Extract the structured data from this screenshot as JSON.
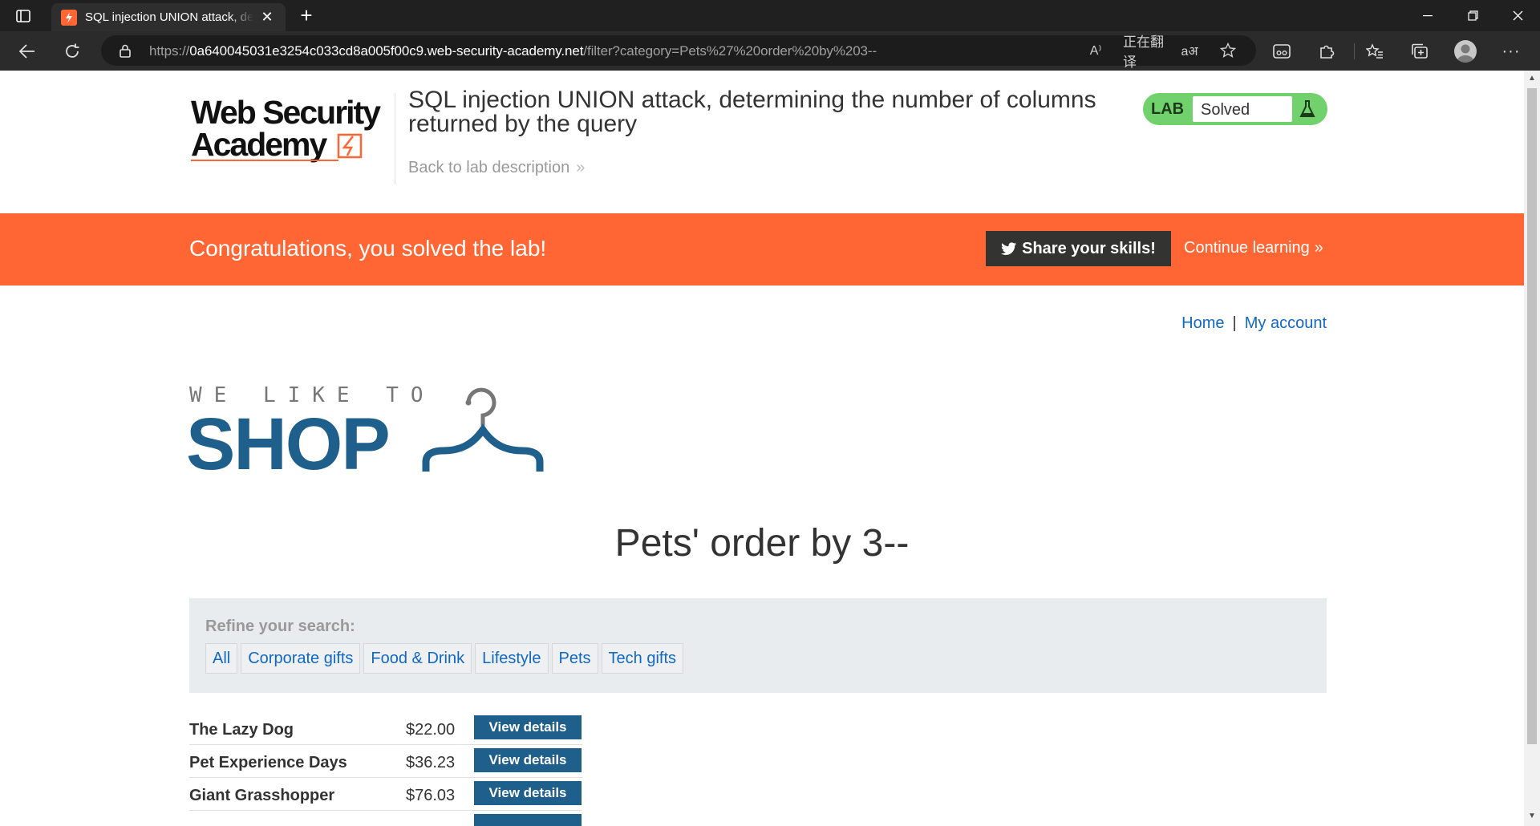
{
  "browser": {
    "tab_title": "SQL injection UNION attack, dete",
    "new_tab_symbol": "+",
    "url_prefix": "https://",
    "url_host": "0a640045031e3254c033cd8a005f00c9.web-security-academy.net",
    "url_path": "/filter?category=Pets%27%20order%20by%203--",
    "read_aloud": "A⁾",
    "translate_label": "正在翻译",
    "translate_icon": "aअ"
  },
  "lab": {
    "title": "SQL injection UNION attack, determining the number of columns returned by the query",
    "back_link": "Back to lab description",
    "status_label": "LAB",
    "status_value": "Solved",
    "logo_line1": "Web Security",
    "logo_line2": "Academy"
  },
  "banner": {
    "message": "Congratulations, you solved the lab!",
    "share_label": "Share your skills!",
    "continue_label": "Continue learning"
  },
  "nav": {
    "home": "Home",
    "separator": "|",
    "account": "My account"
  },
  "shop": {
    "tagline": "WE LIKE TO",
    "name": "SHOP"
  },
  "page": {
    "heading": "Pets' order by 3--",
    "refine_label": "Refine your search:",
    "categories": [
      "All",
      "Corporate gifts",
      "Food & Drink",
      "Lifestyle",
      "Pets",
      "Tech gifts"
    ]
  },
  "products": [
    {
      "name": "The Lazy Dog",
      "price": "$22.00",
      "button": "View details"
    },
    {
      "name": "Pet Experience Days",
      "price": "$36.23",
      "button": "View details"
    },
    {
      "name": "Giant Grasshopper",
      "price": "$76.03",
      "button": "View details"
    },
    {
      "name": "",
      "price": "",
      "button": ""
    }
  ],
  "colors": {
    "accent_orange": "#ff6633",
    "shop_blue": "#1f5f8b",
    "link_blue": "#1168c4",
    "lab_green": "#70d16d"
  }
}
